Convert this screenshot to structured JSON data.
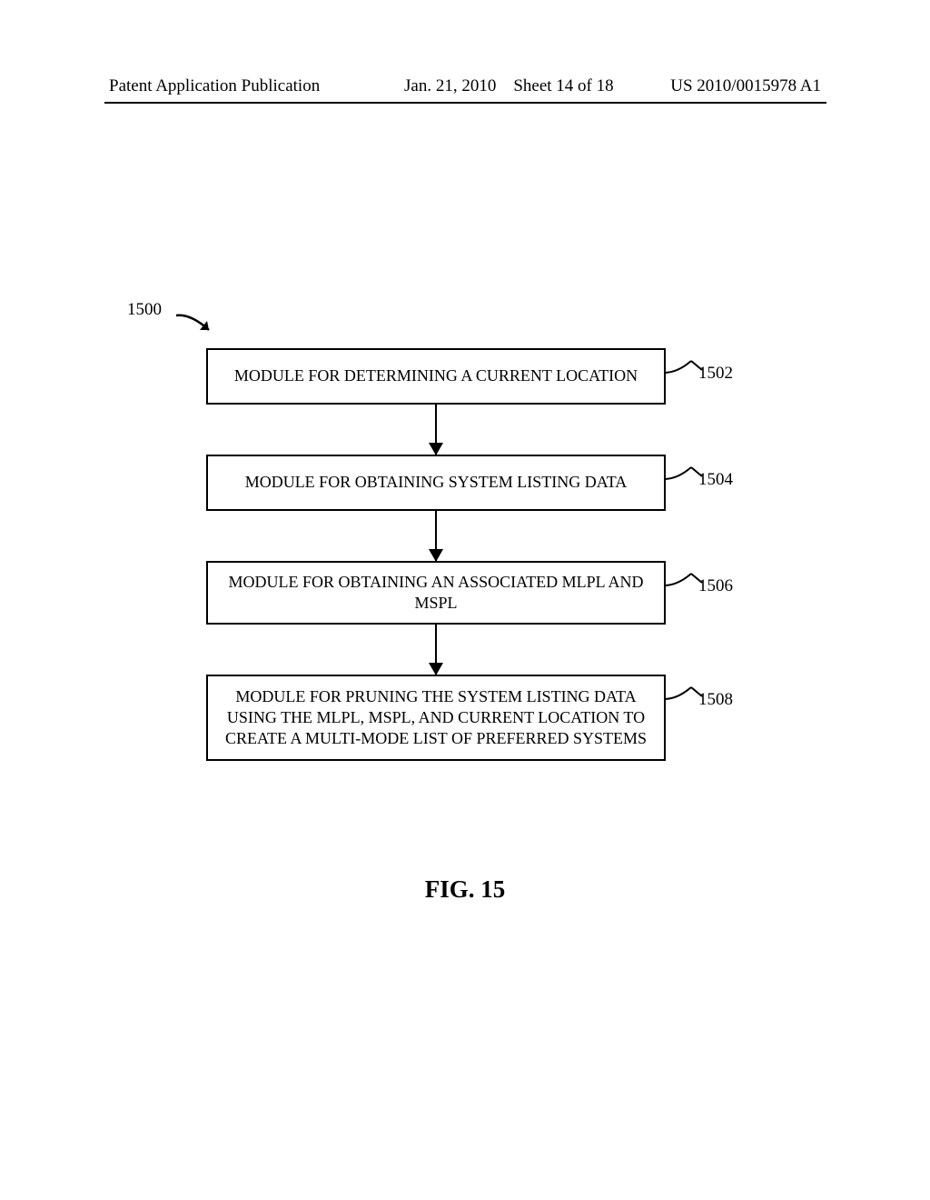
{
  "header": {
    "left": "Patent Application Publication",
    "mid_date": "Jan. 21, 2010",
    "mid_sheet": "Sheet 14 of 18",
    "right": "US 2010/0015978 A1"
  },
  "diagram_ref": "1500",
  "boxes": [
    {
      "id": "box-1502",
      "label": "1502",
      "text": "MODULE FOR DETERMINING A CURRENT LOCATION"
    },
    {
      "id": "box-1504",
      "label": "1504",
      "text": "MODULE FOR OBTAINING SYSTEM LISTING DATA"
    },
    {
      "id": "box-1506",
      "label": "1506",
      "text": "MODULE FOR OBTAINING AN ASSOCIATED MLPL AND MSPL"
    },
    {
      "id": "box-1508",
      "label": "1508",
      "text": "MODULE FOR PRUNING THE SYSTEM LISTING DATA USING THE MLPL, MSPL, AND CURRENT LOCATION TO CREATE A MULTI-MODE LIST OF PREFERRED SYSTEMS"
    }
  ],
  "figure_caption": "FIG. 15"
}
